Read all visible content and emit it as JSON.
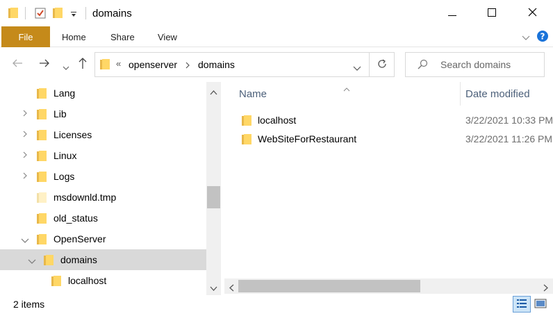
{
  "window": {
    "title": "domains"
  },
  "ribbon": {
    "tabs": [
      "File",
      "Home",
      "Share",
      "View"
    ]
  },
  "address": {
    "segments": [
      "openserver",
      "domains"
    ],
    "overflow": "«"
  },
  "search": {
    "placeholder": "Search domains"
  },
  "nav_tree": [
    {
      "label": "Lang",
      "expander": ""
    },
    {
      "label": "Lib",
      "expander": ">"
    },
    {
      "label": "Licenses",
      "expander": ">"
    },
    {
      "label": "Linux",
      "expander": ">"
    },
    {
      "label": "Logs",
      "expander": ">"
    },
    {
      "label": "msdownld.tmp",
      "expander": ""
    },
    {
      "label": "old_status",
      "expander": ""
    },
    {
      "label": "OpenServer",
      "expander": "v"
    },
    {
      "label": "domains",
      "expander": "v",
      "selected": true
    },
    {
      "label": "localhost",
      "expander": ""
    }
  ],
  "columns": {
    "name": "Name",
    "date": "Date modified"
  },
  "files": [
    {
      "name": "localhost",
      "date": "3/22/2021 10:33 PM"
    },
    {
      "name": "WebSiteForRestaurant",
      "date": "3/22/2021 11:26 PM"
    }
  ],
  "status": {
    "item_count": "2 items"
  },
  "colors": {
    "accent_file_tab": "#c58a1a",
    "folder": "#ffd766",
    "header_text": "#4c607a",
    "selection": "#d9d9d9"
  },
  "icons": [
    "folder-icon",
    "properties-icon",
    "dropdown-icon",
    "minimize-icon",
    "maximize-icon",
    "close-icon",
    "help-icon",
    "back-icon",
    "forward-icon",
    "up-icon",
    "refresh-icon",
    "search-icon",
    "details-view-icon",
    "large-icons-view-icon"
  ]
}
